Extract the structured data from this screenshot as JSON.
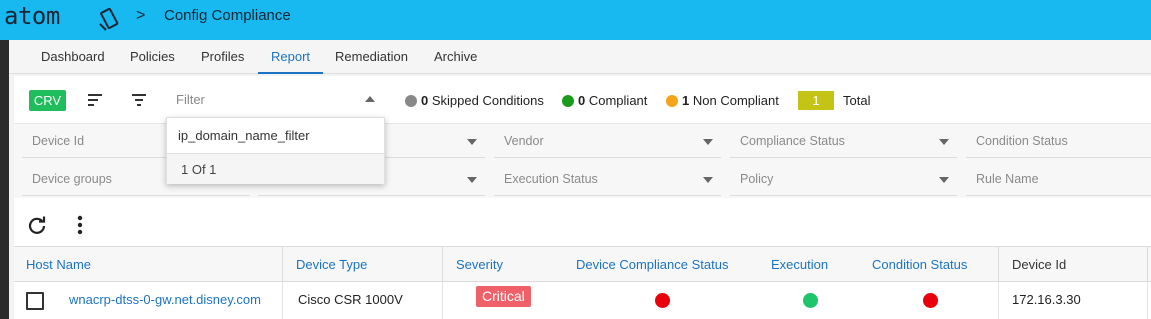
{
  "app": {
    "logo": "atom",
    "crumb_sep": ">",
    "title": "Config Compliance"
  },
  "tabs": [
    {
      "label": "Dashboard"
    },
    {
      "label": "Policies"
    },
    {
      "label": "Profiles"
    },
    {
      "label": "Report"
    },
    {
      "label": "Remediation"
    },
    {
      "label": "Archive"
    }
  ],
  "active_tab": "Report",
  "toolbar": {
    "crv_label": "CRV",
    "filter_placeholder": "Filter",
    "legend": {
      "skipped": {
        "count": "0",
        "label": "Skipped Conditions",
        "color": "#888888"
      },
      "compliant": {
        "count": "0",
        "label": "Compliant",
        "color": "#1a9a1a"
      },
      "non_compliant": {
        "count": "1",
        "label": "Non Compliant",
        "color": "#f4a417"
      }
    },
    "total": {
      "count": "1",
      "label": "Total"
    }
  },
  "filters": {
    "device_id": "Device Id",
    "vendor": "Vendor",
    "compliance_status": "Compliance Status",
    "condition_status": "Condition Status",
    "device_groups": "Device groups",
    "execution_status": "Execution Status",
    "policy": "Policy",
    "rule_name": "Rule Name"
  },
  "dropdown": {
    "item": "ip_domain_name_filter",
    "count": "1 Of 1"
  },
  "table": {
    "headers": {
      "host_name": "Host Name",
      "device_type": "Device Type",
      "severity": "Severity",
      "device_compliance_status": "Device Compliance Status",
      "execution": "Execution",
      "condition_status": "Condition Status",
      "device_id": "Device Id"
    },
    "rows": [
      {
        "host_name": "wnacrp-dtss-0-gw.net.disney.com",
        "device_type": "Cisco CSR 1000V",
        "severity": "Critical",
        "device_compliance_color": "#e8000b",
        "execution_color": "#1fc46b",
        "condition_color": "#e8000b",
        "device_id": "172.16.3.30"
      }
    ]
  }
}
